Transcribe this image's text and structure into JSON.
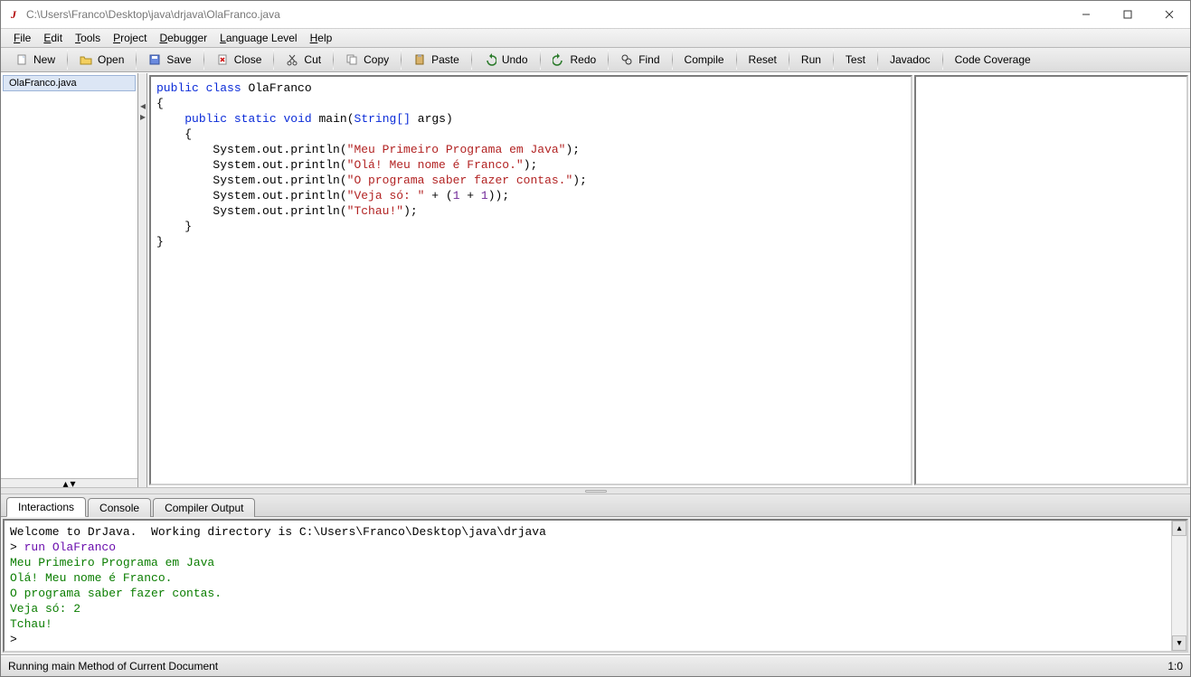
{
  "title": "C:\\Users\\Franco\\Desktop\\java\\drjava\\OlaFranco.java",
  "menu": {
    "file": "File",
    "edit": "Edit",
    "tools": "Tools",
    "project": "Project",
    "debugger": "Debugger",
    "language": "Language Level",
    "help": "Help"
  },
  "toolbar": {
    "new": "New",
    "open": "Open",
    "save": "Save",
    "close": "Close",
    "cut": "Cut",
    "copy": "Copy",
    "paste": "Paste",
    "undo": "Undo",
    "redo": "Redo",
    "find": "Find",
    "compile": "Compile",
    "reset": "Reset",
    "run": "Run",
    "test": "Test",
    "javadoc": "Javadoc",
    "coverage": "Code Coverage"
  },
  "sidebar": {
    "open_file": "OlaFranco.java"
  },
  "code": {
    "class_name": "OlaFranco",
    "method_sig_main": "main",
    "arg_type": "String[]",
    "arg_name": "args",
    "s1": "\"Meu Primeiro Programa em Java\"",
    "s2": "\"Olá! Meu nome é Franco.\"",
    "s3": "\"O programa saber fazer contas.\"",
    "s4": "\"Veja só: \"",
    "s5": "\"Tchau!\"",
    "lit1": "1",
    "lit2": "1"
  },
  "tabs": {
    "interactions": "Interactions",
    "console": "Console",
    "compiler": "Compiler Output"
  },
  "console": {
    "welcome": "Welcome to DrJava.  Working directory is C:\\Users\\Franco\\Desktop\\java\\drjava",
    "prompt1": "> ",
    "cmd": "run OlaFranco",
    "out1": "Meu Primeiro Programa em Java",
    "out2": "Olá! Meu nome é Franco.",
    "out3": "O programa saber fazer contas.",
    "out4": "Veja só: 2",
    "out5": "Tchau!",
    "prompt2": ">"
  },
  "status": {
    "left": "Running main Method of Current Document",
    "right": "1:0"
  }
}
